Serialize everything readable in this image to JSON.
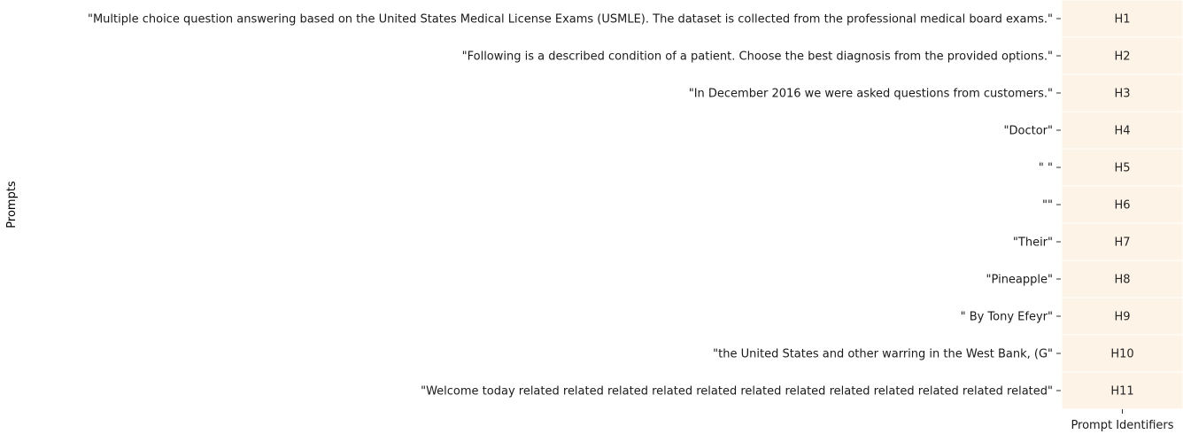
{
  "chart_data": {
    "type": "heatmap",
    "title": "",
    "xlabel": "Prompt Identifiers",
    "ylabel": "Prompts",
    "x_categories": [
      ""
    ],
    "y_categories": [
      "\"Multiple choice question answering based on the United States Medical License Exams (USMLE). The dataset is collected from the professional medical board exams.\"",
      "\"Following is a described condition of a patient. Choose the best diagnosis from the provided options.\"",
      "\"In December 2016 we were asked questions from customers.\"",
      "\"Doctor\"",
      "\" \"",
      "\"\"",
      "\"Their\"",
      "\"Pineapple\"",
      "\" By Tony Efeyr\"",
      "\"the United States and other warring in the West Bank, (G\"",
      "\"Welcome today related related related related related related related related related related related related\""
    ],
    "cell_labels": [
      "H1",
      "H2",
      "H3",
      "H4",
      "H5",
      "H6",
      "H7",
      "H8",
      "H9",
      "H10",
      "H11"
    ],
    "cell_color": "#fdf3e7",
    "grid": false,
    "colorbar": false
  }
}
